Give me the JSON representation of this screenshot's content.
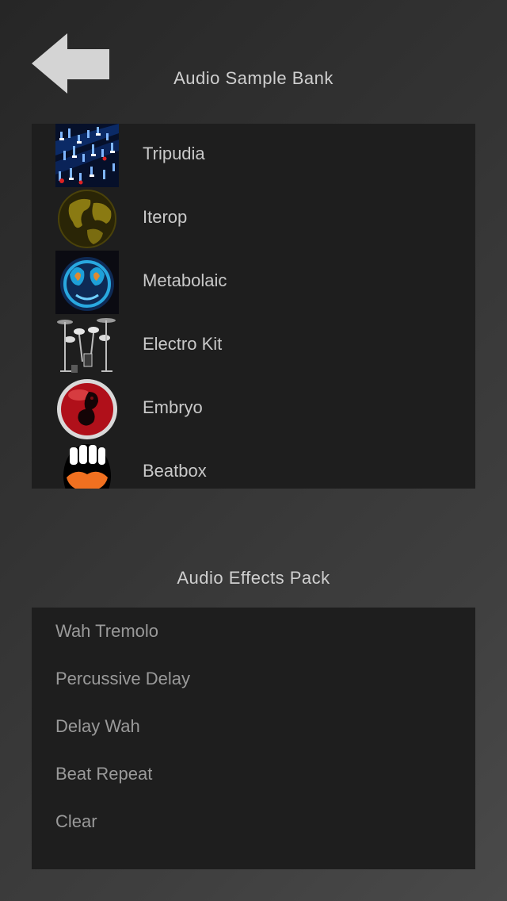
{
  "header": {
    "back_icon": "left-arrow-icon",
    "sample_bank_title": "Audio Sample Bank"
  },
  "sample_bank": {
    "items": [
      {
        "label": "Tripudia",
        "icon": "mixer-board-icon"
      },
      {
        "label": "Iterop",
        "icon": "globe-icon"
      },
      {
        "label": "Metabolaic",
        "icon": "blue-orb-icon"
      },
      {
        "label": "Electro Kit",
        "icon": "drum-kit-icon"
      },
      {
        "label": "Embryo",
        "icon": "embryo-icon"
      },
      {
        "label": "Beatbox",
        "icon": "mouth-icon"
      }
    ]
  },
  "effects": {
    "title": "Audio Effects Pack",
    "items": [
      {
        "label": "Wah Tremolo"
      },
      {
        "label": "Percussive Delay"
      },
      {
        "label": "Delay Wah"
      },
      {
        "label": "Beat Repeat"
      },
      {
        "label": "Clear"
      }
    ]
  },
  "colors": {
    "panel": "#1e1e1e",
    "title_text": "#cfcfcf",
    "sample_text": "#c9c9c9",
    "effect_text": "#9a9a9a",
    "arrow": "#d4d4d4"
  }
}
